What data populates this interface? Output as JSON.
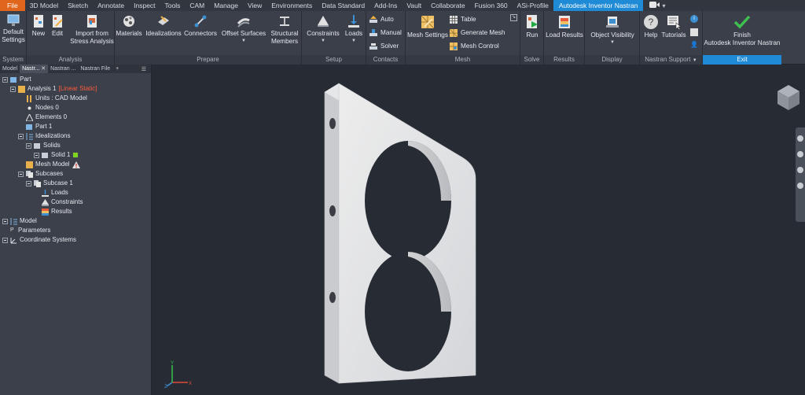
{
  "menu": {
    "tabs": [
      "File",
      "3D Model",
      "Sketch",
      "Annotate",
      "Inspect",
      "Tools",
      "CAM",
      "Manage",
      "View",
      "Environments",
      "Data Standard",
      "Add-Ins",
      "Vault",
      "Collaborate",
      "Fusion 360",
      "ASi-Profile",
      "Autodesk Inventor Nastran"
    ],
    "active_tab": "Autodesk Inventor Nastran"
  },
  "ribbon": {
    "system": {
      "label": "System",
      "default_settings": "Default\nSettings"
    },
    "analysis": {
      "label": "Analysis",
      "new": "New",
      "edit": "Edit",
      "import": "Import from\nStress Analysis"
    },
    "prepare": {
      "label": "Prepare",
      "materials": "Materials",
      "idealizations": "Idealizations",
      "connectors": "Connectors",
      "offset_surfaces": "Offset Surfaces",
      "structural_members": "Structural\nMembers"
    },
    "setup": {
      "label": "Setup",
      "constraints": "Constraints",
      "loads": "Loads"
    },
    "contacts": {
      "label": "Contacts",
      "auto": "Auto",
      "manual": "Manual",
      "solver": "Solver"
    },
    "mesh": {
      "label": "Mesh",
      "mesh_settings": "Mesh Settings",
      "table": "Table",
      "generate_mesh": "Generate Mesh",
      "mesh_control": "Mesh Control"
    },
    "solve": {
      "label": "Solve",
      "run": "Run"
    },
    "results": {
      "label": "Results",
      "load_results": "Load Results"
    },
    "display": {
      "label": "Display",
      "object_visibility": "Object Visibility"
    },
    "support": {
      "label": "Nastran Support",
      "help": "Help",
      "tutorials": "Tutorials"
    },
    "exit": {
      "label": "Exit",
      "finish": "Finish\nAutodesk Inventor Nastran"
    }
  },
  "browser": {
    "tabs": [
      "Model",
      "Nastr...",
      "Nastran ...",
      "Nastran File"
    ],
    "tree": {
      "part": "Part",
      "analysis": "Analysis 1",
      "analysis_type": "[Linear Static]",
      "units": "Units : CAD Model",
      "nodes": "Nodes 0",
      "elements": "Elements 0",
      "part1": "Part 1",
      "idealizations": "Idealizations",
      "solids": "Solids",
      "solid1": "Solid 1",
      "mesh_model": "Mesh Model",
      "subcases": "Subcases",
      "subcase1": "Subcase 1",
      "loads": "Loads",
      "constraints": "Constraints",
      "results": "Results",
      "model": "Model",
      "parameters": "Parameters",
      "coord_systems": "Coordinate Systems"
    }
  },
  "triad": {
    "x": "X",
    "y": "Y",
    "z": "Z"
  },
  "colors": {
    "accent": "#1f8ad6",
    "file_tab": "#e0651d",
    "linear_static": "#ff5a3c",
    "ribbon_bg": "#3a3f49",
    "viewport_bg": "#272b34"
  }
}
